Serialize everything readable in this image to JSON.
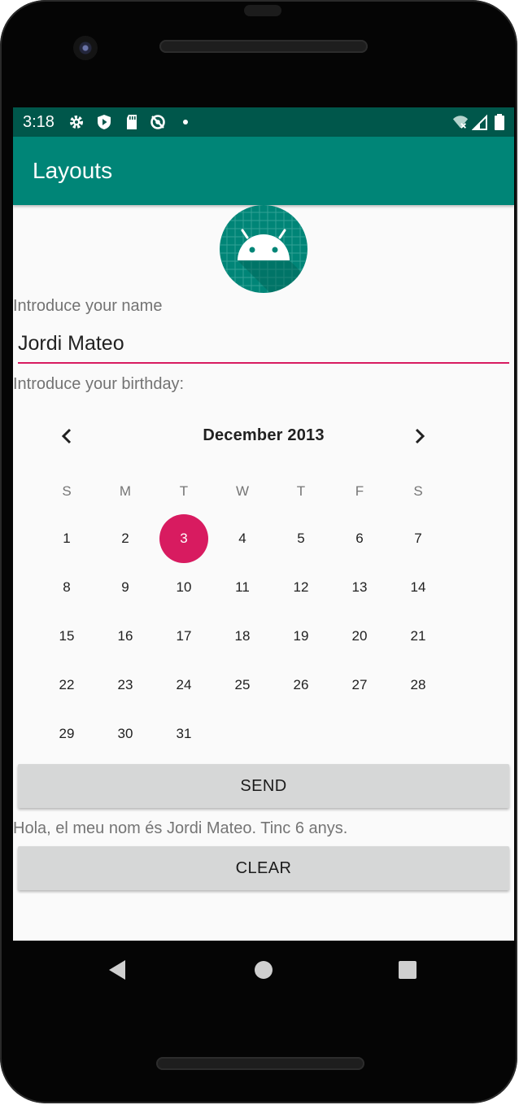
{
  "status": {
    "time": "3:18"
  },
  "app": {
    "title": "Layouts"
  },
  "form": {
    "name_label": "Introduce your name",
    "name_value": "Jordi Mateo",
    "birthday_label": "Introduce your birthday:"
  },
  "calendar": {
    "month_title": "December 2013",
    "weekdays": [
      "S",
      "M",
      "T",
      "W",
      "T",
      "F",
      "S"
    ],
    "days": [
      "1",
      "2",
      "3",
      "4",
      "5",
      "6",
      "7",
      "8",
      "9",
      "10",
      "11",
      "12",
      "13",
      "14",
      "15",
      "16",
      "17",
      "18",
      "19",
      "20",
      "21",
      "22",
      "23",
      "24",
      "25",
      "26",
      "27",
      "28",
      "29",
      "30",
      "31"
    ],
    "selected_day": "3"
  },
  "actions": {
    "send_label": "SEND",
    "clear_label": "CLEAR"
  },
  "result": {
    "text": "Hola, el meu nom és Jordi Mateo. Tinc 6 anys."
  },
  "colors": {
    "primary": "#008577",
    "primary_dark": "#00574b",
    "accent": "#d81b60",
    "button": "#d6d7d7"
  },
  "icons": {
    "status": [
      "gear-icon",
      "shield-play-icon",
      "sd-card-icon",
      "sync-off-icon",
      "dot-icon",
      "wifi-off-icon",
      "signal-icon",
      "battery-icon"
    ],
    "nav": [
      "back-icon",
      "home-icon",
      "recents-icon"
    ],
    "calendar": [
      "chevron-left-icon",
      "chevron-right-icon"
    ]
  }
}
